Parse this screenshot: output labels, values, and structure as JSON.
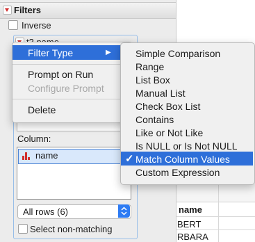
{
  "panel": {
    "header_title": "Filters",
    "inverse_label": "Inverse",
    "filter_name": "t3.name",
    "column_label": "Column:",
    "column_item": "name",
    "rows_select_value": "All rows (6)",
    "select_nonmatching_label": "Select non-matching"
  },
  "context_menu": {
    "items": [
      {
        "label": "Filter Type"
      },
      {
        "label": "Prompt on Run"
      },
      {
        "label": "Configure Prompt"
      },
      {
        "label": "Delete"
      }
    ],
    "submenu_arrow": "▶"
  },
  "submenu": {
    "checkmark": "✓",
    "items": [
      {
        "label": "Simple Comparison"
      },
      {
        "label": "Range"
      },
      {
        "label": "List Box"
      },
      {
        "label": "Manual List"
      },
      {
        "label": "Check Box List"
      },
      {
        "label": "Contains"
      },
      {
        "label": "Like or Not Like"
      },
      {
        "label": "Is NULL or Is Not NULL"
      },
      {
        "label": "Match Column Values"
      },
      {
        "label": "Custom Expression"
      }
    ]
  },
  "grid": {
    "header": "name",
    "rows": [
      "BERT",
      "RBARA"
    ]
  },
  "colors": {
    "highlight": "#2e6fd9",
    "accent_red": "#d12e2e"
  }
}
